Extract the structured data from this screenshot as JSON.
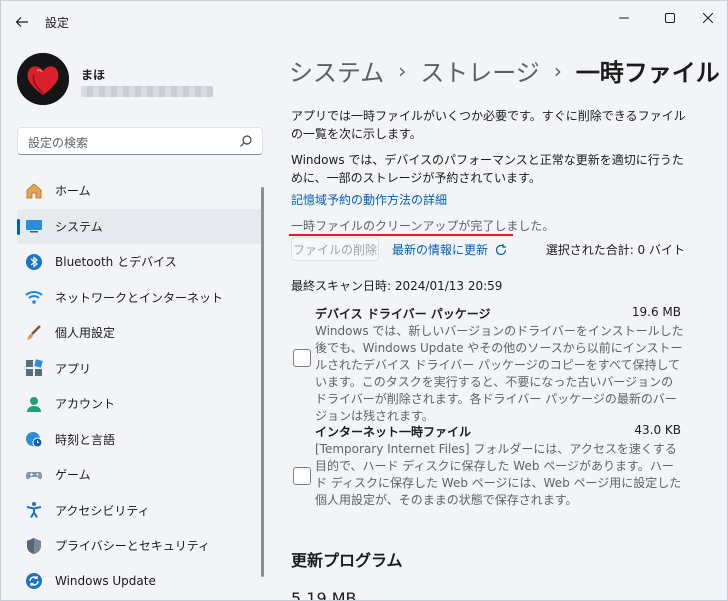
{
  "window": {
    "title": "設定",
    "controls": [
      "minimize-icon",
      "maximize-icon",
      "close-icon"
    ]
  },
  "user": {
    "name": "まほ"
  },
  "search": {
    "placeholder": "設定の検索"
  },
  "nav": [
    {
      "label": "ホーム",
      "icon": "home-icon"
    },
    {
      "label": "システム",
      "icon": "system-icon",
      "selected": true
    },
    {
      "label": "Bluetooth とデバイス",
      "icon": "bluetooth-icon"
    },
    {
      "label": "ネットワークとインターネット",
      "icon": "wifi-icon"
    },
    {
      "label": "個人用設定",
      "icon": "brush-icon"
    },
    {
      "label": "アプリ",
      "icon": "apps-icon"
    },
    {
      "label": "アカウント",
      "icon": "account-icon"
    },
    {
      "label": "時刻と言語",
      "icon": "globe-clock-icon"
    },
    {
      "label": "ゲーム",
      "icon": "gamepad-icon"
    },
    {
      "label": "アクセシビリティ",
      "icon": "accessibility-icon"
    },
    {
      "label": "プライバシーとセキュリティ",
      "icon": "shield-icon"
    },
    {
      "label": "Windows Update",
      "icon": "update-icon"
    }
  ],
  "breadcrumb": {
    "parts": [
      "システム",
      "ストレージ"
    ],
    "separator": "›",
    "current": "一時ファイル"
  },
  "content": {
    "intro": "アプリでは一時ファイルがいくつか必要です。すぐに削除できるファイルの一覧を次に示します。",
    "intro2": "Windows では、デバイスのパフォーマンスと正常な更新を適切に行うために、一部のストレージが予約されています。",
    "reserved_link": "記憶域予約の動作方法の詳細",
    "complete_message": "一時ファイルのクリーンアップが完了しました。",
    "delete_button": "ファイルの削除",
    "refresh_link": "最新の情報に更新",
    "selected_total": "選択された合計: 0 バイト",
    "last_scan": "最終スキャン日時: 2024/01/13 20:59",
    "items": [
      {
        "title": "デバイス ドライバー パッケージ",
        "size": "19.6 MB",
        "checked": false,
        "description": "Windows では、新しいバージョンのドライバーをインストールした後でも、Windows Update やその他のソースから以前にインストールされたデバイス ドライバー パッケージのコピーをすべて保持しています。このタスクを実行すると、不要になった古いバージョンのドライバーが削除されます。各ドライバー パッケージの最新のバージョンは残されます。"
      },
      {
        "title": "インターネット一時ファイル",
        "size": "43.0 KB",
        "checked": false,
        "description": "[Temporary Internet Files] フォルダーには、アクセスを速くする目的で、ハード ディスクに保存した Web ページがあります。ハード ディスクに保存した Web ページには、Web ページ用に設定した個人用設定が、そのままの状態で保存されます。"
      }
    ],
    "section_title": "更新プログラム",
    "section_size": "5.19 MB"
  },
  "colors": {
    "accent": "#005fb8",
    "annotation_line": "#e01e1e",
    "background": "#f2f4f7"
  }
}
